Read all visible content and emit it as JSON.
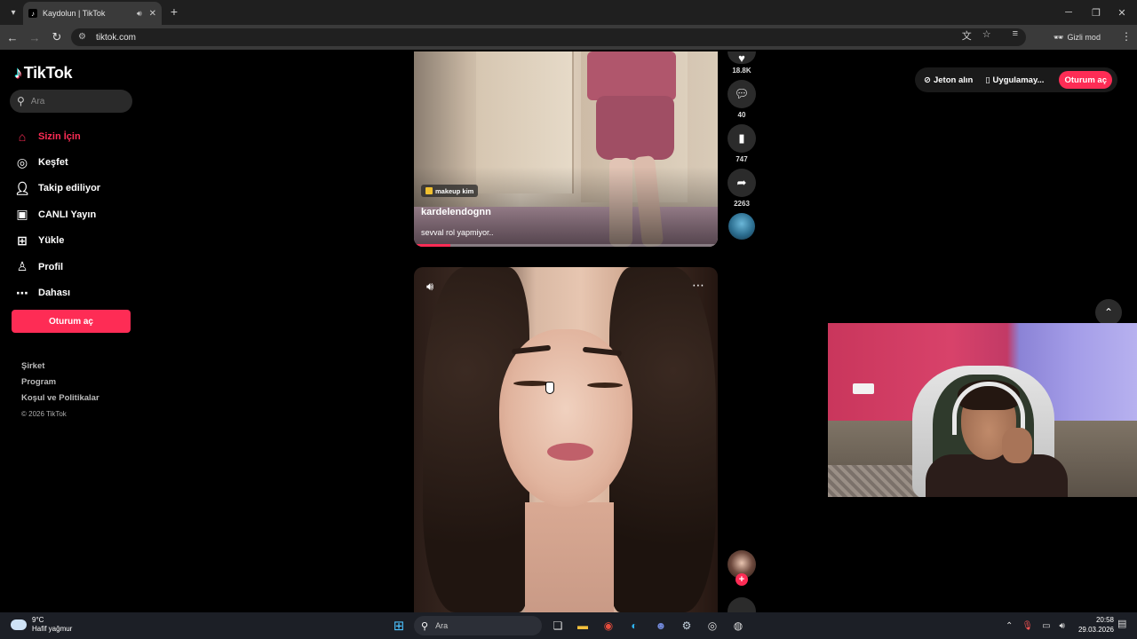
{
  "browser": {
    "tab_title": "Kaydolun | TikTok",
    "url": "tiktok.com",
    "incognito_label": "Gizli mod"
  },
  "sidebar": {
    "logo_text": "TikTok",
    "search_placeholder": "Ara",
    "nav": [
      {
        "label": "Sizin İçin",
        "icon": "home-icon",
        "active": true
      },
      {
        "label": "Keşfet",
        "icon": "compass-icon",
        "active": false
      },
      {
        "label": "Takip ediliyor",
        "icon": "following-icon",
        "active": false
      },
      {
        "label": "CANLI Yayın",
        "icon": "live-icon",
        "active": false
      },
      {
        "label": "Yükle",
        "icon": "upload-icon",
        "active": false
      },
      {
        "label": "Profil",
        "icon": "profile-icon",
        "active": false
      },
      {
        "label": "Dahası",
        "icon": "more-icon",
        "active": false
      }
    ],
    "login_button": "Oturum aç",
    "footer": {
      "company": "Şirket",
      "program": "Program",
      "policies": "Koşul ve Politikalar",
      "copyright": "© 2026 TikTok"
    }
  },
  "topbar": {
    "coins": "Jeton alın",
    "app": "Uygulamay...",
    "login": "Oturum aç"
  },
  "video1": {
    "tag": "makeup kim",
    "author": "kardelendognn",
    "caption": "sevval rol yapmiyor..",
    "progress": 0.12,
    "likes": "18.8K",
    "comments": "40",
    "saves": "747",
    "shares": "2263"
  },
  "taskbar": {
    "temp": "9°C",
    "weather": "Hafif yağmur",
    "search_placeholder": "Ara",
    "time": "20:58",
    "date": "29.03.2026"
  },
  "colors": {
    "accent": "#fe2c55",
    "background": "#000000"
  }
}
